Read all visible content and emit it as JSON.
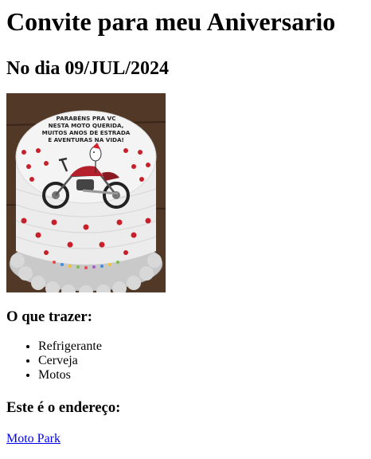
{
  "title": "Convite para meu Aniversario",
  "date_heading": "No dia 09/JUL/2024",
  "image": {
    "name": "moto-cake-photo",
    "caption_lines": [
      "PARABÉNS PRA VC",
      "NESTA MOTO QUERIDA,",
      "MUITOS ANOS DE ESTRADA",
      "E AVENTURAS NA VIDA!"
    ]
  },
  "bring_heading": "O que trazer:",
  "bring_items": [
    {
      "label": "Refrigerante"
    },
    {
      "label": "Cerveja"
    },
    {
      "label": "Motos"
    }
  ],
  "address_heading": "Este é o endereço:",
  "address_link": "Moto Park",
  "colors": {
    "link": "#0000ee",
    "text": "#000000",
    "background": "#ffffff"
  }
}
